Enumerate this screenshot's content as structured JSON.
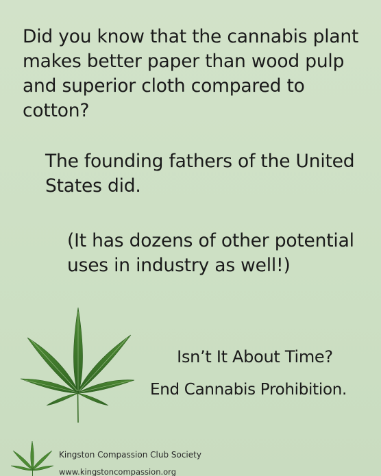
{
  "poster": {
    "paragraph1": "Did you know that the cannabis plant makes better paper than wood pulp and superior cloth compared to cotton?",
    "paragraph2": "The founding fathers of the United States did.",
    "paragraph3": "(It has dozens of other potential uses in industry as well!)",
    "cta_line1": "Isn’t It About Time?",
    "cta_line2": "End Cannabis Prohibition.",
    "organization": "Kingston Compassion Club Society",
    "website": "www.kingstoncompassion.org"
  },
  "icons": {
    "main_leaf": "cannabis-leaf-icon",
    "logo_leaf": "cannabis-leaf-logo-icon"
  },
  "colors": {
    "background": "#cfe0c6",
    "text": "#1a1a1a",
    "leaf_green": "#3f7a2e"
  }
}
